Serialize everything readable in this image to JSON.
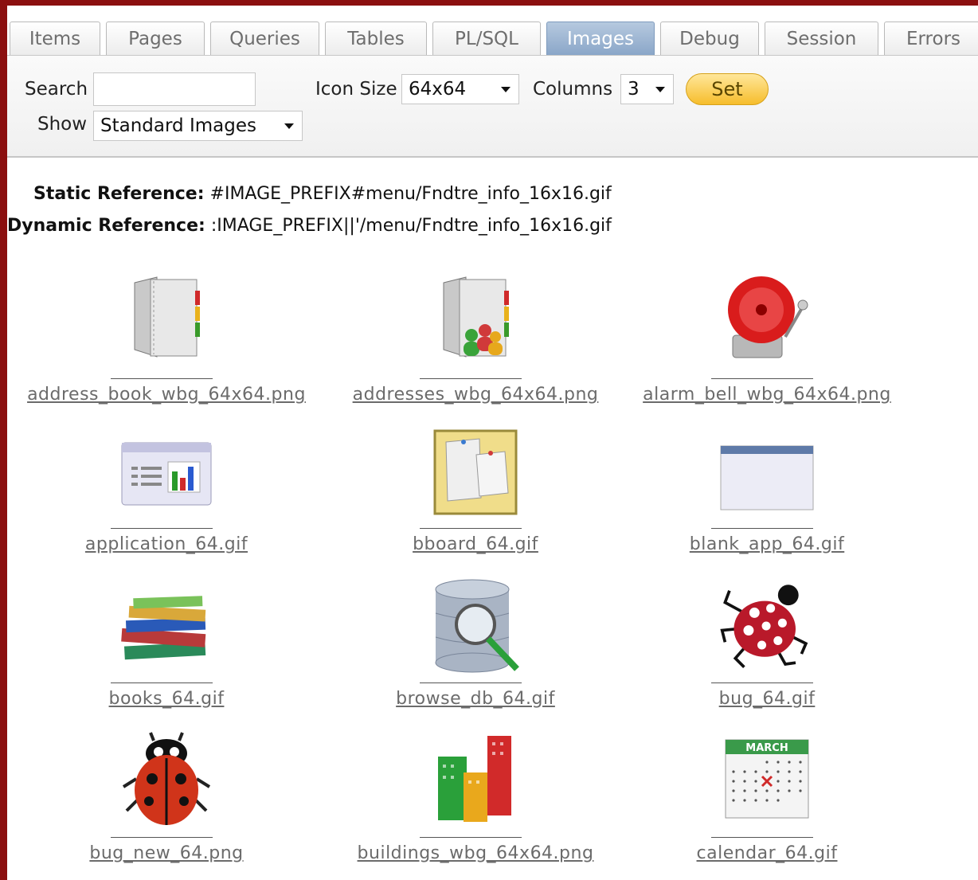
{
  "tabs": [
    {
      "label": "Items"
    },
    {
      "label": "Pages"
    },
    {
      "label": "Queries"
    },
    {
      "label": "Tables"
    },
    {
      "label": "PL/SQL"
    },
    {
      "label": "Images"
    },
    {
      "label": "Debug"
    },
    {
      "label": "Session"
    },
    {
      "label": "Errors"
    }
  ],
  "toolbar": {
    "search_label": "Search",
    "search_value": "",
    "icon_size_label": "Icon Size",
    "icon_size_value": "64x64",
    "columns_label": "Columns",
    "columns_value": "3",
    "set_label": "Set",
    "show_label": "Show",
    "show_value": "Standard Images"
  },
  "references": {
    "static_label": "Static Reference:",
    "static_value": "#IMAGE_PREFIX#menu/Fndtre_info_16x16.gif",
    "dynamic_label": "Dynamic Reference:",
    "dynamic_value": ":IMAGE_PREFIX||'/menu/Fndtre_info_16x16.gif"
  },
  "images": [
    {
      "name": "address_book_wbg_64x64.png",
      "icon": "address-book-icon"
    },
    {
      "name": "addresses_wbg_64x64.png",
      "icon": "addresses-icon"
    },
    {
      "name": "alarm_bell_wbg_64x64.png",
      "icon": "alarm-bell-icon"
    },
    {
      "name": "application_64.gif",
      "icon": "application-icon"
    },
    {
      "name": "bboard_64.gif",
      "icon": "bulletin-board-icon"
    },
    {
      "name": "blank_app_64.gif",
      "icon": "blank-app-icon"
    },
    {
      "name": "books_64.gif",
      "icon": "books-icon"
    },
    {
      "name": "browse_db_64.gif",
      "icon": "browse-db-icon"
    },
    {
      "name": "bug_64.gif",
      "icon": "bug-icon"
    },
    {
      "name": "bug_new_64.png",
      "icon": "bug-new-icon"
    },
    {
      "name": "buildings_wbg_64x64.png",
      "icon": "buildings-icon"
    },
    {
      "name": "calendar_64.gif",
      "icon": "calendar-icon"
    }
  ],
  "calendar_icon": {
    "month": "MARCH"
  },
  "colors": {
    "border": "#8b0f0f",
    "active_tab": "#8aa6c8",
    "set_button": "#f6bd2c",
    "link": "#6b6b6b"
  }
}
